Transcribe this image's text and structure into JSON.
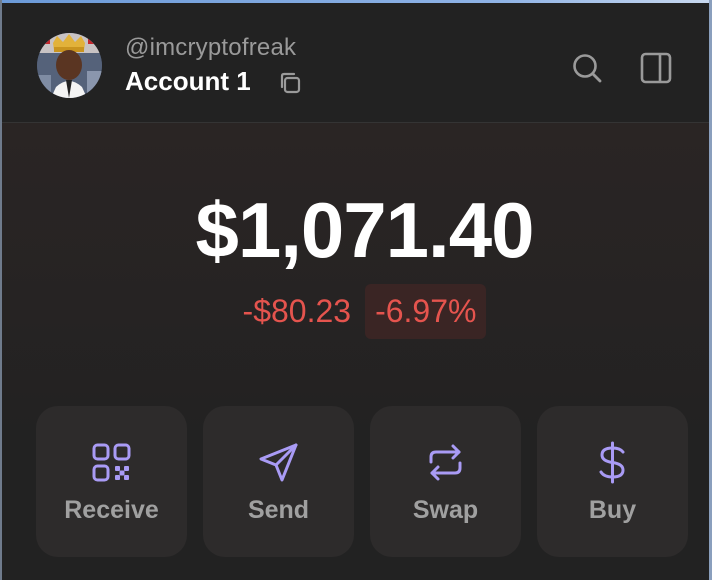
{
  "header": {
    "handle": "@imcryptofreak",
    "account_name": "Account 1",
    "avatar_icon": "profile-avatar-image",
    "copy_icon": "copy-icon",
    "search_icon": "search-icon",
    "panel_icon": "side-panel-icon"
  },
  "balance": {
    "total": "$1,071.40",
    "change_amount": "-$80.23",
    "change_percent": "-6.97%"
  },
  "actions": [
    {
      "label": "Receive",
      "icon": "qr-code-icon"
    },
    {
      "label": "Send",
      "icon": "paper-plane-icon"
    },
    {
      "label": "Swap",
      "icon": "swap-arrows-icon"
    },
    {
      "label": "Buy",
      "icon": "dollar-icon"
    }
  ],
  "colors": {
    "background": "#222222",
    "negative": "#e5544e",
    "negative_badge_bg": "#3a2524",
    "accent_icon": "#a99bf5",
    "button_bg": "#2d2b2b",
    "muted_text": "#9a9a9a"
  }
}
